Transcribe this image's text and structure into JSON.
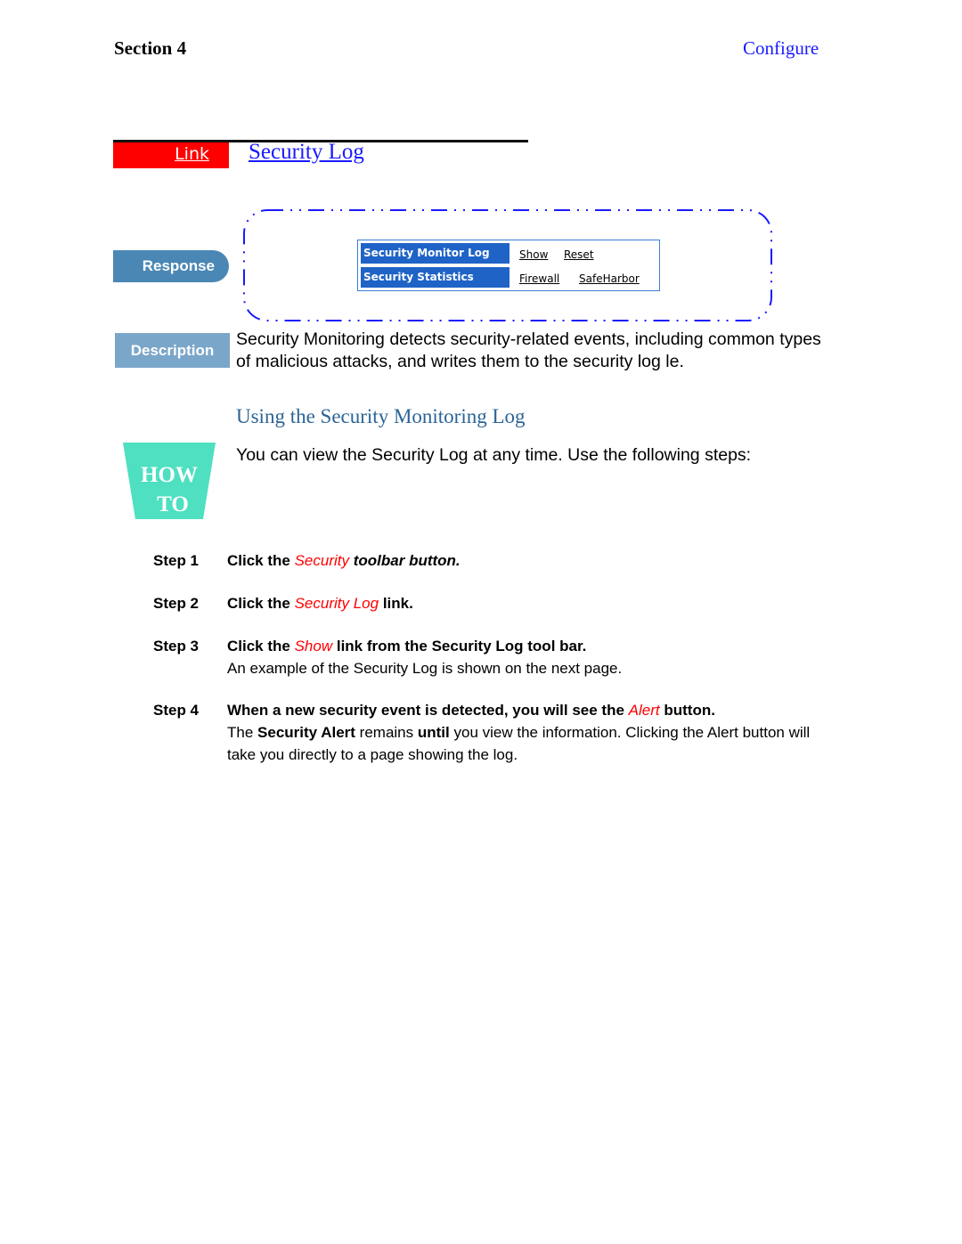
{
  "header": {
    "section": "Section 4",
    "chapter": "Configure"
  },
  "title_bar": {
    "tag_label": "Link",
    "title": "Security Log"
  },
  "response": {
    "tab_label": "Response",
    "toolbar": {
      "rows": [
        {
          "label": "Security Monitor Log",
          "links": [
            "Show",
            "Reset"
          ]
        },
        {
          "label": "Security Statistics",
          "links": [
            "Firewall",
            "SafeHarbor"
          ]
        }
      ]
    }
  },
  "description": {
    "tab_label": "Description",
    "text": "Security Monitoring detects security-related events, including common types of malicious attacks, and writes them to the security log  le."
  },
  "howto": {
    "icon_line1": "HOW",
    "icon_line2": "TO",
    "heading": "Using the Security Monitoring Log",
    "intro": "You can view the Security Log at any time. Use the following steps:"
  },
  "steps": [
    {
      "label": "Step 1",
      "pre": "Click the ",
      "em": "Security",
      "post": " toolbar button."
    },
    {
      "label": "Step 2",
      "pre": "Click the ",
      "em": "Security Log",
      "post": " link."
    },
    {
      "label": "Step 3",
      "pre": "Click the ",
      "em": "Show",
      "post": " link from the Security Log tool bar.",
      "sub": "An example of the Security Log is shown on the next page."
    },
    {
      "label": "Step 4",
      "pre": "When a new security event is detected, you will see the ",
      "em": "Alert",
      "post": " button.",
      "sub_parts": {
        "p1": "The ",
        "b1": "Security Alert",
        "p2": " remains ",
        "b2": "until",
        "p3": " you view the information. Clicking the Alert button will take you directly to a page showing the log."
      }
    }
  ],
  "colors": {
    "link_tag": "#ff0000",
    "title_link": "#1a1aff",
    "toolbar_blue": "#1f63c7",
    "heading_blue": "#2b6496",
    "howto_teal": "#4ee0c0"
  }
}
